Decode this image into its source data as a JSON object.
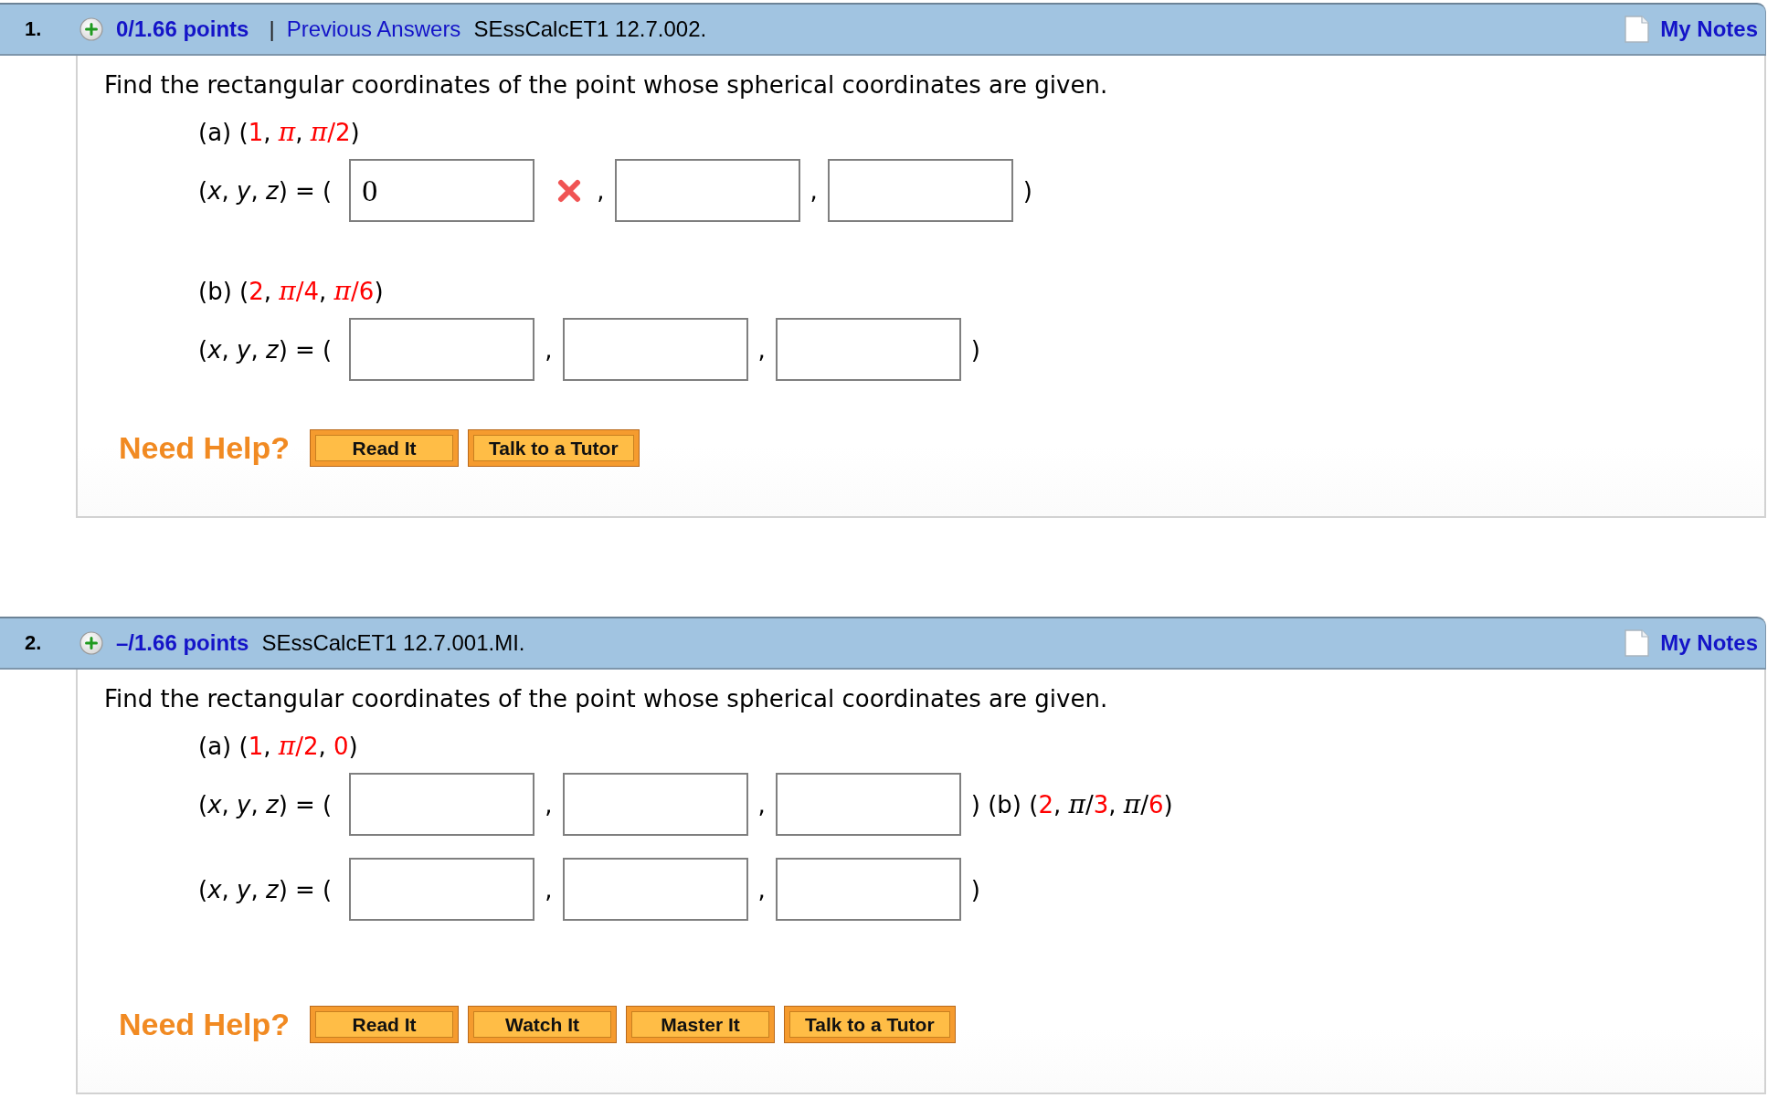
{
  "questions": [
    {
      "number": "1.",
      "points": "0/1.66 points",
      "separator": "|",
      "previous_answers": "Previous Answers",
      "code": "SEssCalcET1 12.7.002.",
      "notes": "My Notes",
      "prompt": "Find the rectangular coordinates of the point whose spherical coordinates are given.",
      "lines": [
        {
          "kind": "given",
          "segments": [
            {
              "kind": "plain",
              "text": "(a) ("
            },
            {
              "kind": "given",
              "text": "1"
            },
            {
              "kind": "plain",
              "text": ", "
            },
            {
              "kind": "givensymbol",
              "text": "π"
            },
            {
              "kind": "plain",
              "text": ", "
            },
            {
              "kind": "givensymbol",
              "text": "π"
            },
            {
              "kind": "given",
              "text": "/2"
            },
            {
              "kind": "plain",
              "text": ")"
            }
          ]
        },
        {
          "kind": "answers",
          "items": [
            {
              "kind": "text",
              "text": "(*x*, *y*, *z*) = ("
            },
            {
              "kind": "field",
              "value": "0",
              "incorrect": true
            },
            {
              "kind": "text",
              "text": ","
            },
            {
              "kind": "field",
              "incorrect": false
            },
            {
              "kind": "text",
              "text": ","
            },
            {
              "kind": "field",
              "incorrect": false
            },
            {
              "kind": "text",
              "text": ")"
            }
          ]
        },
        {
          "kind": "given",
          "segments": [
            {
              "kind": "plain",
              "text": "(b) ("
            },
            {
              "kind": "given",
              "text": "2"
            },
            {
              "kind": "plain",
              "text": ", "
            },
            {
              "kind": "givensymbol",
              "text": "π"
            },
            {
              "kind": "given",
              "text": "/4"
            },
            {
              "kind": "plain",
              "text": ", "
            },
            {
              "kind": "givensymbol",
              "text": "π"
            },
            {
              "kind": "given",
              "text": "/6"
            },
            {
              "kind": "plain",
              "text": ")"
            }
          ]
        },
        {
          "kind": "answers",
          "items": [
            {
              "kind": "text",
              "text": "(*x*, *y*, *z*) = ("
            },
            {
              "kind": "field",
              "incorrect": false
            },
            {
              "kind": "text",
              "text": ","
            },
            {
              "kind": "field",
              "incorrect": false
            },
            {
              "kind": "text",
              "text": ","
            },
            {
              "kind": "field",
              "incorrect": false
            },
            {
              "kind": "text",
              "text": ")"
            }
          ]
        }
      ],
      "help": {
        "label": "Need Help?",
        "buttons": [
          "Read It",
          "Talk to a Tutor"
        ]
      }
    },
    {
      "number": "2.",
      "points": "–/1.66 points",
      "code": "SEssCalcET1 12.7.001.MI.",
      "notes": "My Notes",
      "prompt": "Find the rectangular coordinates of the point whose spherical coordinates are given.",
      "lines": [
        {
          "kind": "given",
          "segments": [
            {
              "kind": "plain",
              "text": "(a) ("
            },
            {
              "kind": "given",
              "text": "1"
            },
            {
              "kind": "plain",
              "text": ", "
            },
            {
              "kind": "givensymbol",
              "text": "π"
            },
            {
              "kind": "given",
              "text": "/2"
            },
            {
              "kind": "plain",
              "text": ", "
            },
            {
              "kind": "given",
              "text": "0"
            },
            {
              "kind": "plain",
              "text": ")"
            }
          ]
        },
        {
          "kind": "answers",
          "items": [
            {
              "kind": "text",
              "text": "(*x*, *y*, *z*) = ("
            },
            {
              "kind": "field",
              "incorrect": false
            },
            {
              "kind": "text",
              "text": ","
            },
            {
              "kind": "field",
              "incorrect": false
            },
            {
              "kind": "text",
              "text": ","
            },
            {
              "kind": "field",
              "incorrect": false
            },
            {
              "kind": "text",
              "segments": [
                {
                  "kind": "plain",
                  "text": ") (b) ("
                },
                {
                  "kind": "given",
                  "text": "2"
                },
                {
                  "kind": "plain",
                  "text": ", "
                },
                {
                  "kind": "symbol",
                  "text": "π"
                },
                {
                  "kind": "plain",
                  "text": "/"
                },
                {
                  "kind": "given",
                  "text": "3"
                },
                {
                  "kind": "plain",
                  "text": ", "
                },
                {
                  "kind": "symbol",
                  "text": "π"
                },
                {
                  "kind": "plain",
                  "text": "/"
                },
                {
                  "kind": "given",
                  "text": "6"
                },
                {
                  "kind": "plain",
                  "text": ")"
                }
              ]
            }
          ]
        },
        {
          "kind": "answers",
          "items": [
            {
              "kind": "text",
              "text": "(*x*, *y*, *z*) = ("
            },
            {
              "kind": "field",
              "incorrect": false
            },
            {
              "kind": "text",
              "text": ","
            },
            {
              "kind": "field",
              "incorrect": false
            },
            {
              "kind": "text",
              "text": ","
            },
            {
              "kind": "field",
              "incorrect": false
            },
            {
              "kind": "text",
              "text": ")"
            }
          ]
        }
      ],
      "help": {
        "label": "Need Help?",
        "buttons": [
          "Read It",
          "Watch It",
          "Master It",
          "Talk to a Tutor"
        ]
      }
    }
  ]
}
